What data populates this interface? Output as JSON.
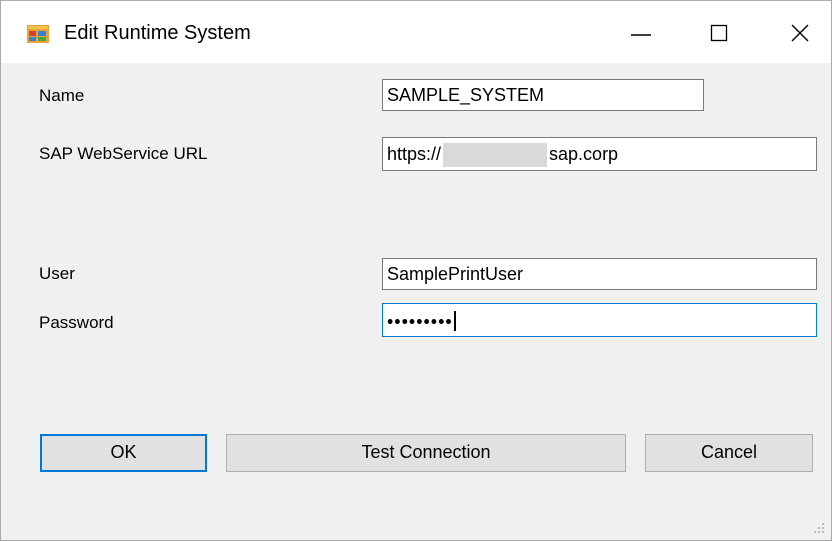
{
  "window": {
    "title": "Edit Runtime System",
    "minimize_icon": "minimize-icon",
    "maximize_icon": "maximize-icon",
    "close_icon": "close-icon",
    "app_icon": "form-window-icon"
  },
  "form": {
    "name_label": "Name",
    "name_value": "SAMPLE_SYSTEM",
    "url_label": "SAP WebService URL",
    "url_value_prefix": "https://",
    "url_value_suffix": "sap.corp",
    "user_label": "User",
    "user_value": "SamplePrintUser",
    "password_label": "Password",
    "password_value": "•••••••••"
  },
  "buttons": {
    "ok_label": "OK",
    "test_label": "Test Connection",
    "cancel_label": "Cancel"
  },
  "colors": {
    "accent": "#0078d7",
    "window_bg": "#f0f0f0",
    "button_bg": "#e1e1e1"
  }
}
